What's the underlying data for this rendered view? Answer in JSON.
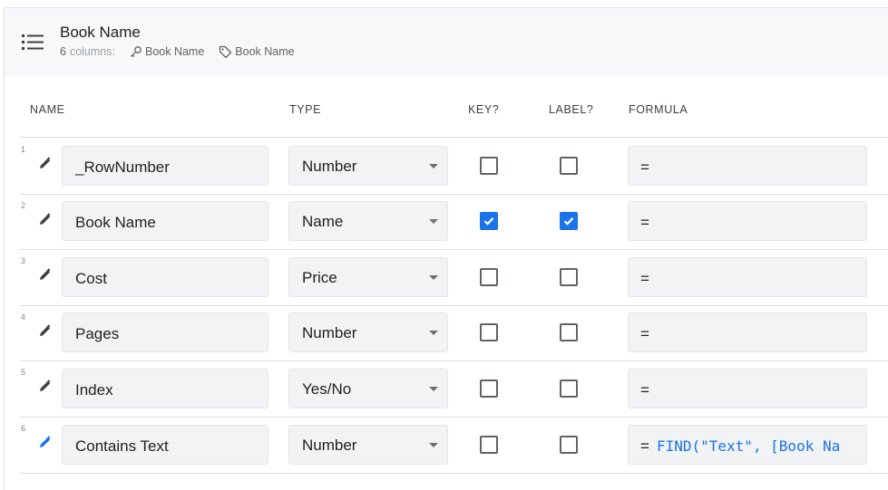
{
  "table": {
    "name": "Book Name",
    "column_count": "6",
    "columns_word": "columns:",
    "key_column": "Book Name",
    "label_column": "Book Name"
  },
  "headers": {
    "name": "NAME",
    "type": "TYPE",
    "key": "KEY?",
    "label": "LABEL?",
    "formula": "FORMULA"
  },
  "rows": [
    {
      "num": "1",
      "name": "_RowNumber",
      "type": "Number",
      "key": false,
      "label": false,
      "formula_prefix": "=",
      "formula": ""
    },
    {
      "num": "2",
      "name": "Book Name",
      "type": "Name",
      "key": true,
      "label": true,
      "formula_prefix": "=",
      "formula": ""
    },
    {
      "num": "3",
      "name": "Cost",
      "type": "Price",
      "key": false,
      "label": false,
      "formula_prefix": "=",
      "formula": ""
    },
    {
      "num": "4",
      "name": "Pages",
      "type": "Number",
      "key": false,
      "label": false,
      "formula_prefix": "=",
      "formula": ""
    },
    {
      "num": "5",
      "name": "Index",
      "type": "Yes/No",
      "key": false,
      "label": false,
      "formula_prefix": "=",
      "formula": ""
    },
    {
      "num": "6",
      "name": "Contains Text",
      "type": "Number",
      "key": false,
      "label": false,
      "formula_prefix": "=",
      "formula": "FIND(\"Text\", [Book Na"
    }
  ],
  "icons": {
    "header": "list-icon",
    "key": "key-icon",
    "label": "tag-icon",
    "edit": "pencil-icon",
    "dropdown": "caret-down-icon",
    "check": "checkmark-icon"
  },
  "colors": {
    "accent": "#1a73e8",
    "edit_active": "#1a73e8",
    "edit_default": "#3c4043"
  }
}
